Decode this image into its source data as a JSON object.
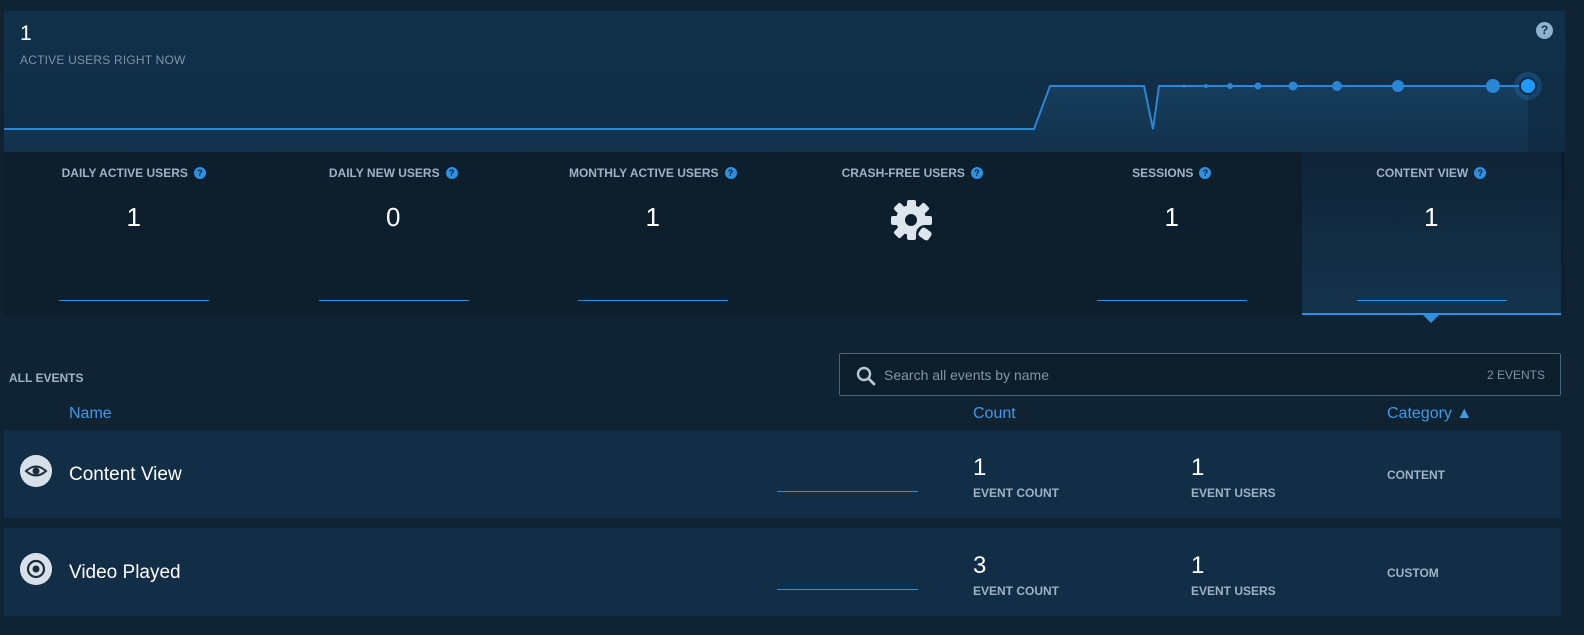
{
  "realtime": {
    "value": "1",
    "label": "ACTIVE USERS RIGHT NOW",
    "help": "?"
  },
  "metrics": [
    {
      "title": "DAILY ACTIVE USERS",
      "value": "1"
    },
    {
      "title": "DAILY NEW USERS",
      "value": "0"
    },
    {
      "title": "MONTHLY ACTIVE USERS",
      "value": "1"
    },
    {
      "title": "CRASH-FREE USERS",
      "value": "",
      "icon": "gear-badge-icon"
    },
    {
      "title": "SESSIONS",
      "value": "1"
    },
    {
      "title": "CONTENT VIEW",
      "value": "1",
      "selected": true
    }
  ],
  "events": {
    "section_label": "ALL EVENTS",
    "search_placeholder": "Search all events by name",
    "search_count": "2 EVENTS",
    "columns": {
      "name": "Name",
      "count": "Count",
      "category": "Category ▲"
    },
    "rows": [
      {
        "icon": "eye-icon",
        "name": "Content View",
        "event_count": "1",
        "event_count_label": "EVENT COUNT",
        "event_users": "1",
        "event_users_label": "EVENT USERS",
        "category": "CONTENT"
      },
      {
        "icon": "target-icon",
        "name": "Video Played",
        "event_count": "3",
        "event_count_label": "EVENT COUNT",
        "event_users": "1",
        "event_users_label": "EVENT USERS",
        "category": "CUSTOM"
      }
    ]
  },
  "colors": {
    "accent": "#2f8fe0",
    "background": "#0f2333",
    "panel": "#112e46"
  }
}
